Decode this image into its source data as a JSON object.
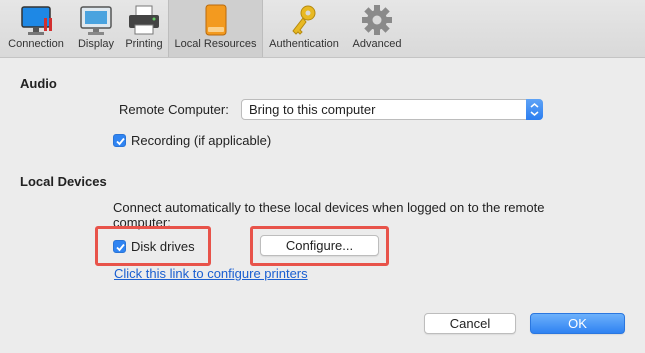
{
  "toolbar": {
    "tabs": [
      {
        "label": "Connection",
        "icon": "monitor-connection-icon"
      },
      {
        "label": "Display",
        "icon": "display-icon"
      },
      {
        "label": "Printing",
        "icon": "printer-icon"
      },
      {
        "label": "Local Resources",
        "icon": "drive-icon",
        "selected": true
      },
      {
        "label": "Authentication",
        "icon": "key-icon"
      },
      {
        "label": "Advanced",
        "icon": "gear-icon"
      }
    ]
  },
  "audio": {
    "heading": "Audio",
    "remote_label": "Remote Computer:",
    "remote_value": "Bring to this computer",
    "recording_label": "Recording (if applicable)",
    "recording_checked": true
  },
  "devices": {
    "heading": "Local Devices",
    "desc_line1": "Connect automatically to these local devices when logged on to the remote",
    "desc_line2": "computer:",
    "disk_label": "Disk drives",
    "disk_checked": true,
    "configure_label": "Configure...",
    "printers_link": "Click this link to configure printers"
  },
  "footer": {
    "cancel_label": "Cancel",
    "ok_label": "OK"
  },
  "colors": {
    "accent": "#2f84f2",
    "highlight": "#e8534a",
    "link": "#1a5fd1"
  }
}
